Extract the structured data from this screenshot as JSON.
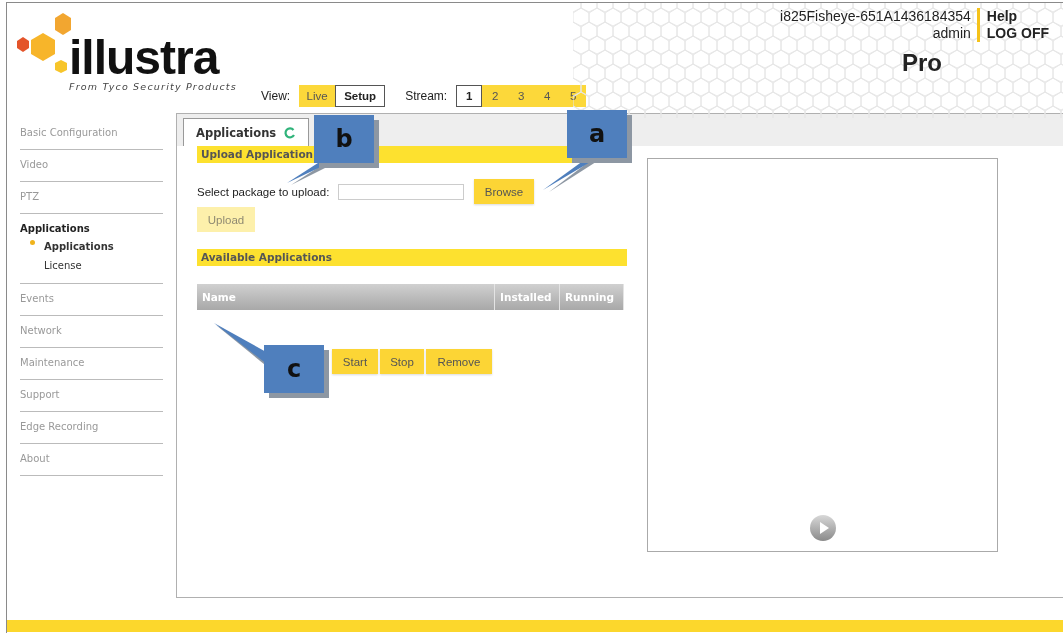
{
  "header": {
    "logo": {
      "wordmark": "illustra",
      "tagline": "From Tyco Security Products"
    },
    "device_name": "i825Fisheye-651A1436184354",
    "user": "admin",
    "links": [
      "Help",
      "LOG OFF"
    ],
    "edition": "Pro",
    "view": {
      "label": "View:",
      "options": [
        {
          "label": "Live",
          "selected": false
        },
        {
          "label": "Setup",
          "selected": true
        }
      ]
    },
    "stream": {
      "label": "Stream:",
      "options": [
        {
          "label": "1",
          "selected": true
        },
        {
          "label": "2",
          "selected": false
        },
        {
          "label": "3",
          "selected": false
        },
        {
          "label": "4",
          "selected": false
        },
        {
          "label": "5",
          "selected": false
        }
      ]
    }
  },
  "sidebar": {
    "items": [
      {
        "label": "Basic Configuration",
        "selected": false
      },
      {
        "label": "Video",
        "selected": false
      },
      {
        "label": "PTZ",
        "selected": false
      },
      {
        "label": "Applications",
        "selected": true,
        "children": [
          {
            "label": "Applications",
            "selected": true
          },
          {
            "label": "License",
            "selected": false
          }
        ]
      },
      {
        "label": "Events",
        "selected": false
      },
      {
        "label": "Network",
        "selected": false
      },
      {
        "label": "Maintenance",
        "selected": false
      },
      {
        "label": "Support",
        "selected": false
      },
      {
        "label": "Edge Recording",
        "selected": false
      },
      {
        "label": "About",
        "selected": false
      }
    ]
  },
  "tab": {
    "label": "Applications",
    "loading": true
  },
  "upload": {
    "title": "Upload Application",
    "field_label": "Select package to upload:",
    "browse": "Browse",
    "upload_button": {
      "label": "Upload",
      "disabled": true
    }
  },
  "available": {
    "title": "Available Applications",
    "columns": [
      "Name",
      "Installed",
      "Running"
    ],
    "actions": [
      "Start",
      "Stop",
      "Remove"
    ]
  },
  "video": {
    "play_button": true
  },
  "callouts": [
    {
      "label": "a"
    },
    {
      "label": "b"
    },
    {
      "label": "c"
    }
  ]
}
